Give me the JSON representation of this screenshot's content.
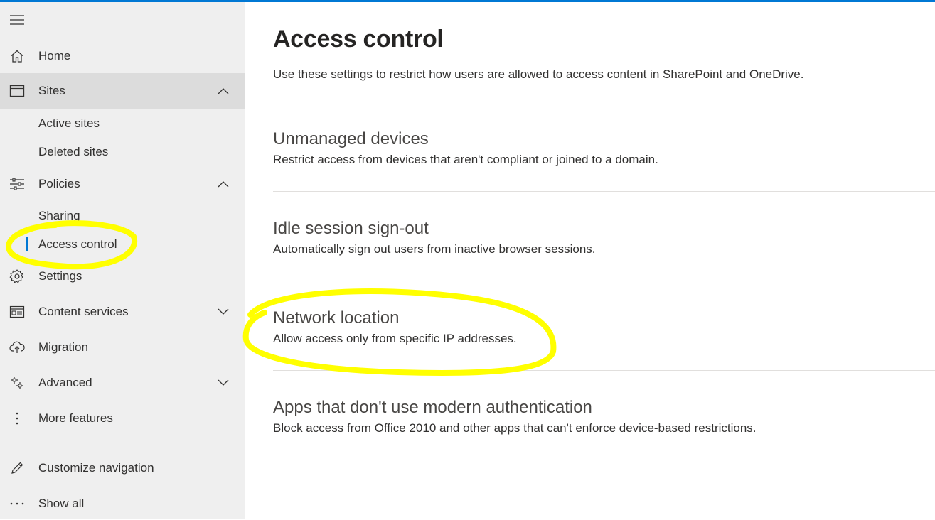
{
  "colors": {
    "accent": "#0078d4",
    "highlight": "#ffff00",
    "sidebar_bg": "#efefef",
    "selected_bg": "#dcdcdc"
  },
  "sidebar": {
    "menu_icon": "hamburger-icon",
    "items": [
      {
        "label": "Home",
        "icon": "home-icon"
      },
      {
        "label": "Sites",
        "icon": "sites-icon",
        "expanded": true,
        "children": [
          {
            "label": "Active sites"
          },
          {
            "label": "Deleted sites"
          }
        ]
      },
      {
        "label": "Policies",
        "icon": "policies-icon",
        "expanded": true,
        "children": [
          {
            "label": "Sharing"
          },
          {
            "label": "Access control",
            "active": true
          }
        ]
      },
      {
        "label": "Settings",
        "icon": "gear-icon"
      },
      {
        "label": "Content services",
        "icon": "content-services-icon",
        "expanded": false
      },
      {
        "label": "Migration",
        "icon": "cloud-upload-icon"
      },
      {
        "label": "Advanced",
        "icon": "advanced-icon",
        "expanded": false
      },
      {
        "label": "More features",
        "icon": "more-vertical-icon"
      }
    ],
    "bottom_items": [
      {
        "label": "Customize navigation",
        "icon": "pencil-icon"
      },
      {
        "label": "Show all",
        "icon": "more-horizontal-icon"
      }
    ]
  },
  "main": {
    "title": "Access control",
    "description": "Use these settings to restrict how users are allowed to access content in SharePoint and OneDrive.",
    "settings": [
      {
        "title": "Unmanaged devices",
        "description": "Restrict access from devices that aren't compliant or joined to a domain."
      },
      {
        "title": "Idle session sign-out",
        "description": "Automatically sign out users from inactive browser sessions."
      },
      {
        "title": "Network location",
        "description": "Allow access only from specific IP addresses."
      },
      {
        "title": "Apps that don't use modern authentication",
        "description": "Block access from Office 2010 and other apps that can't enforce device-based restrictions."
      }
    ]
  }
}
